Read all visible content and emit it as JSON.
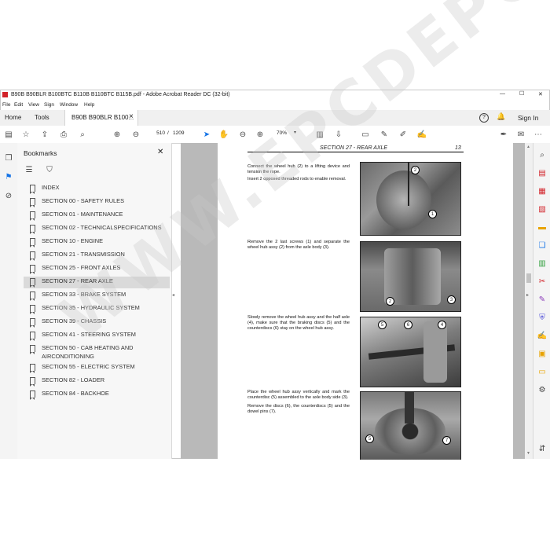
{
  "window": {
    "title": "B90B B90BLR B100BTC B110B B110BTC B115B.pdf - Adobe Acrobat Reader DC (32-bit)",
    "controls": [
      "—",
      "☐",
      "✕"
    ]
  },
  "menu": [
    "File",
    "Edit",
    "View",
    "Sign",
    "Window",
    "Help"
  ],
  "tabs": {
    "home": "Home",
    "tools": "Tools",
    "document": "B90B B90BLR B100...",
    "close": "×",
    "signin": "Sign In"
  },
  "toolbar": {
    "page_current": "510",
    "page_separator": "/",
    "page_total": "1209",
    "zoom": "70%"
  },
  "bookmarks": {
    "title": "Bookmarks",
    "items": [
      "INDEX",
      "SECTION 00 - SAFETY RULES",
      "SECTION 01 - MAINTENANCE",
      "SECTION 02 - TECHNICALSPECIFICATIONS",
      "SECTION 10 - ENGINE",
      "SECTION 21 - TRANSMISSION",
      "SECTION 25 - FRONT AXLES",
      "SECTION 27 - REAR AXLE",
      "SECTION 33 - BRAKE SYSTEM",
      "SECTION 35 - HYDRAULIC SYSTEM",
      "SECTION 39 - CHASSIS",
      "SECTION 41 - STEERING SYSTEM",
      "SECTION 50 - CAB HEATING AND AIRCONDITIONING",
      "SECTION 55 - ELECTRIC SYSTEM",
      "SECTION 82 - LOADER",
      "SECTION 84 - BACKHOE"
    ],
    "selected_index": 7
  },
  "document": {
    "header": "SECTION 27 - REAR AXLE",
    "page_no": "13",
    "steps": [
      "Connect the wheel hub (2) to a lifting device and tension the rope.",
      "Insert 2 opposed threaded rods to enable removal.",
      "Remove the 2 last screws (1) and separate the wheel hub assy (2) from the axle body (3).",
      "Slowly remove the wheel hub assy and the half axle (4), make sure that the braking discs (5) and the counterdiscs (6) stay on the wheel hub assy.",
      "Place the wheel hub assy vertically and mark the counterdisc (5) assembled to the axle body side (3).",
      "Remove the discs (6), the counterdiscs (5) and the dowel pins (7)."
    ],
    "callouts": [
      "2",
      "1",
      "2",
      "3",
      "5",
      "6",
      "4",
      "5",
      "7"
    ]
  },
  "watermark": "WWW.EPCDEPOT.COM"
}
